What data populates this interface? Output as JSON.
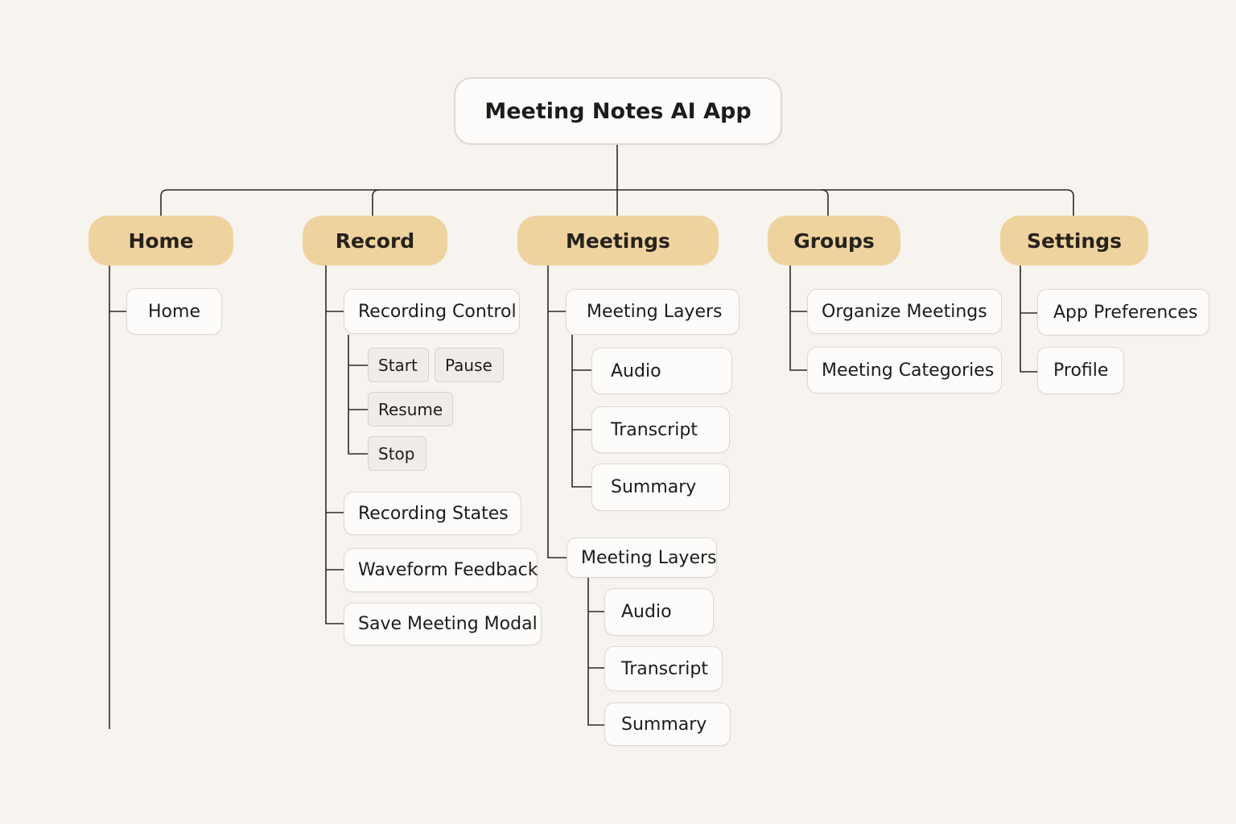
{
  "root": {
    "label": "Meeting Notes AI App"
  },
  "home": {
    "label": "Home",
    "children": [
      "Home"
    ]
  },
  "record": {
    "label": "Record",
    "recording_control": "Recording Control",
    "controls": [
      "Start",
      "Pause",
      "Resume",
      "Stop"
    ],
    "recording_states": "Recording States",
    "waveform_feedback": "Waveform Feedback",
    "save_meeting_modal": "Save Meeting Modal"
  },
  "meetings": {
    "label": "Meetings",
    "layer_groups": [
      {
        "label": "Meeting Layers",
        "children": [
          "Audio",
          "Transcript",
          "Summary"
        ]
      },
      {
        "label": "Meeting Layers",
        "children": [
          "Audio",
          "Transcript",
          "Summary"
        ]
      }
    ]
  },
  "groups": {
    "label": "Groups",
    "children": [
      "Organize Meetings",
      "Meeting Categories"
    ]
  },
  "settings": {
    "label": "Settings",
    "children": [
      "App Preferences",
      "Profile"
    ]
  },
  "colors": {
    "category_fill": "#efd39e",
    "node_fill": "#fdfcfa",
    "chip_fill": "#f0ede8",
    "background": "#f7f4ef",
    "connector": "#2b2926"
  }
}
